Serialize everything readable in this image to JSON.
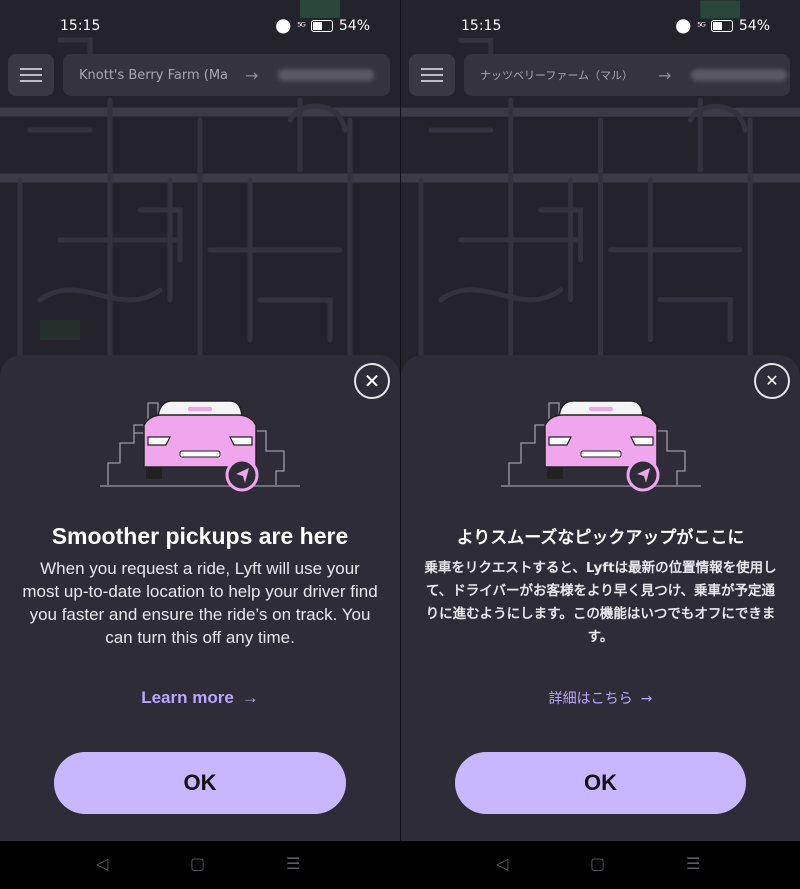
{
  "status": {
    "time": "15:15",
    "battery": "54%",
    "signal": "⁵ᴳ"
  },
  "screens": [
    {
      "id": "en",
      "route": {
        "origin": "Knott's Berry Farm (Mai",
        "arrow": "→"
      },
      "sheet": {
        "title": "Smoother pickups are here",
        "body": "When you request a ride, Lyft will use your most up-to-date location to help your driver find you faster and ensure the ride’s on track. You can turn this off any time.",
        "learn_more": "Learn more",
        "ok": "OK",
        "close": "✕"
      }
    },
    {
      "id": "ja",
      "route": {
        "origin": "ナッツベリーファーム（マル）",
        "arrow": "→"
      },
      "sheet": {
        "title": "よりスムーズなピックアップがここに",
        "body": "乗車をリクエストすると、Lyftは最新の位置情報を使用して、ドライバーがお客様をより早く見つけ、乗車が予定通りに進むようにします。この機能はいつでもオフにできます。",
        "learn_more": "詳細はこちら",
        "ok": "OK",
        "close": "✕"
      }
    }
  ],
  "nav": {
    "back": "◁",
    "home": "▢",
    "recents": "☰"
  },
  "colors": {
    "accent": "#c8b7ff",
    "link": "#b9a6ff",
    "sheet": "#2e2d37",
    "car": "#f0a6ec"
  }
}
